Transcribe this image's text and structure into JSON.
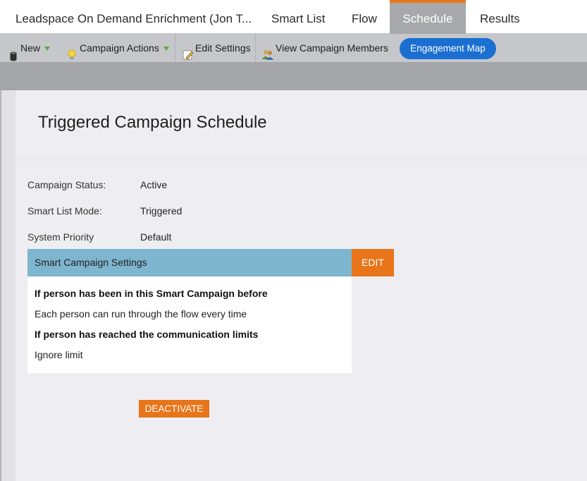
{
  "tabs": {
    "title": "Leadspace On Demand Enrichment (Jon T...",
    "smart_list": "Smart List",
    "flow": "Flow",
    "schedule": "Schedule",
    "results": "Results",
    "active": "Schedule"
  },
  "toolbar": {
    "new_label": "New",
    "campaign_actions_label": "Campaign Actions",
    "edit_settings_label": "Edit Settings",
    "view_members_label": "View Campaign Members",
    "engagement_map_label": "Engagement Map"
  },
  "page": {
    "title": "Triggered Campaign Schedule"
  },
  "fields": {
    "status_label": "Campaign Status:",
    "status_value": "Active",
    "mode_label": "Smart List Mode:",
    "mode_value": "Triggered",
    "priority_label": "System Priority",
    "priority_value": "Default"
  },
  "settings": {
    "header": "Smart Campaign Settings",
    "edit_label": "EDIT",
    "line1": "If person has been in this Smart Campaign before",
    "line2": "Each person can run through the flow every time",
    "line3": "If person has reached the communication limits",
    "line4": "Ignore limit"
  },
  "actions": {
    "deactivate_label": "DEACTIVATE"
  },
  "colors": {
    "accent_orange": "#e8751a",
    "active_tab": "#a7a9ac",
    "engagement_blue": "#1a6fd1",
    "settings_header": "#7eb5cf"
  },
  "icons": {
    "new": "database-icon",
    "campaign_actions": "lightbulb-icon",
    "edit_settings": "pencil-edit-icon",
    "view_members": "people-icon"
  }
}
